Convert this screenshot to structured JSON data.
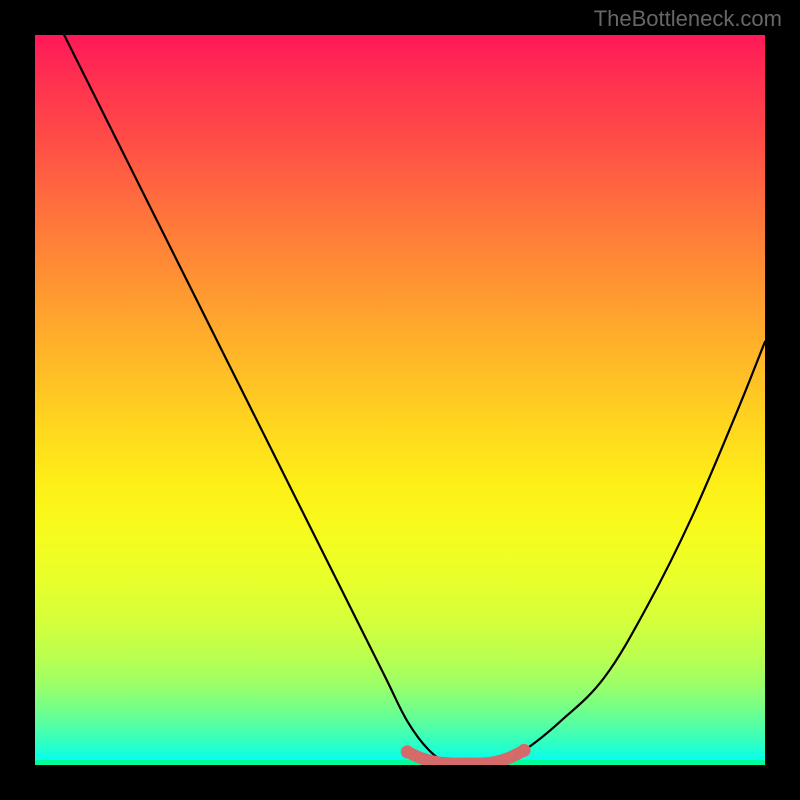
{
  "watermark": "TheBottleneck.com",
  "chart_data": {
    "type": "line",
    "title": "",
    "xlabel": "",
    "ylabel": "",
    "xlim": [
      0,
      100
    ],
    "ylim": [
      0,
      100
    ],
    "grid": false,
    "legend": false,
    "background": "rainbow-gradient",
    "series": [
      {
        "name": "bottleneck-curve",
        "x": [
          4,
          8,
          12,
          16,
          20,
          24,
          28,
          32,
          36,
          40,
          44,
          48,
          51,
          54,
          57,
          60,
          63,
          67,
          72,
          78,
          84,
          90,
          96,
          100
        ],
        "values": [
          100,
          92,
          84,
          76,
          68,
          60,
          52,
          44,
          36,
          28,
          20,
          12,
          6,
          2,
          0,
          0,
          0,
          2,
          6,
          12,
          22,
          34,
          48,
          58
        ]
      }
    ],
    "highlight": {
      "name": "valley-floor",
      "color": "#d46a6a",
      "x": [
        51,
        53,
        55,
        57,
        59,
        61,
        63,
        65,
        67
      ],
      "values": [
        1.8,
        0.9,
        0.4,
        0.2,
        0.2,
        0.2,
        0.4,
        1.0,
        2.0
      ]
    }
  }
}
